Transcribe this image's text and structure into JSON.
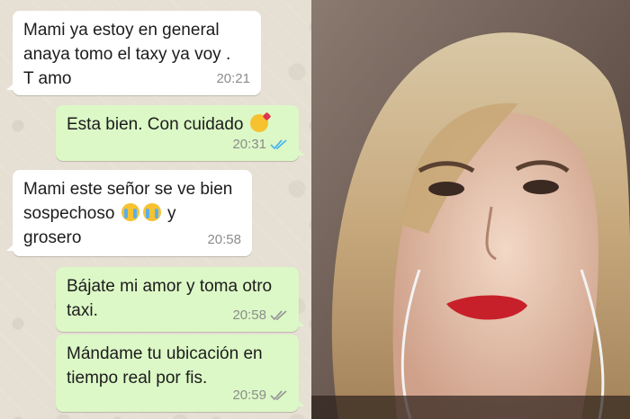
{
  "colors": {
    "incoming_bubble": "#ffffff",
    "outgoing_bubble": "#dcf8c6",
    "read_ticks": "#4fb6ec",
    "delivered_ticks": "#9a9a9a"
  },
  "messages": [
    {
      "direction": "incoming",
      "text": "Mami ya estoy en general\nanaya tomo el taxy  ya voy .\nT  amo",
      "time": "20:21"
    },
    {
      "direction": "outgoing",
      "text": "Esta bien. Con cuidado",
      "emoji": "kissing-face-emoji",
      "time": "20:31",
      "status": "read"
    },
    {
      "direction": "incoming",
      "text": "Mami este señor se ve bien\nsospechoso",
      "emoji": "crying-face-emoji",
      "text_after": "y\ngrosero",
      "time": "20:58"
    },
    {
      "direction": "outgoing",
      "text": "Bájate mi amor y toma otro\ntaxi.",
      "time": "20:58",
      "status": "delivered"
    },
    {
      "direction": "outgoing",
      "text": "Mándame tu ubicación en\ntiempo real por fis.",
      "time": "20:59",
      "status": "delivered"
    }
  ],
  "photo": {
    "subject": "portrait-photo"
  }
}
